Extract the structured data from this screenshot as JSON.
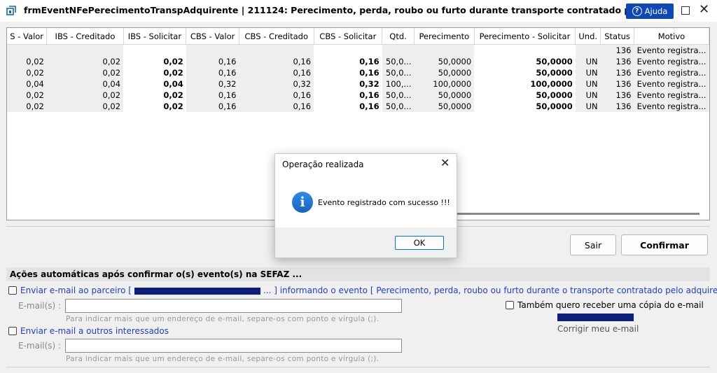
{
  "window": {
    "title": "frmEventNFePerecimentoTranspAdquirente | 211124: Perecimento, perda, roubo ou furto durante transporte contratado pelo",
    "help_label": "Ajuda",
    "app_icon": "document-icon"
  },
  "grid": {
    "columns": [
      "S - Valor",
      "IBS - Creditado",
      "IBS - Solicitar",
      "CBS - Valor",
      "CBS - Creditado",
      "CBS - Solicitar",
      "Qtd.",
      "Perecimento",
      "Perecimento - Solicitar",
      "Und.",
      "Status",
      "Motivo"
    ],
    "rows": [
      [
        "",
        "",
        "",
        "",
        "",
        "",
        "",
        "",
        "",
        "",
        "136",
        "Evento registra..."
      ],
      [
        "0,02",
        "0,02",
        "0,02",
        "0,16",
        "0,16",
        "0,16",
        "50,0...",
        "50,0000",
        "50,0000",
        "UN",
        "136",
        "Evento registra..."
      ],
      [
        "0,02",
        "0,02",
        "0,02",
        "0,16",
        "0,16",
        "0,16",
        "50,0...",
        "50,0000",
        "50,0000",
        "UN",
        "136",
        "Evento registra..."
      ],
      [
        "0,04",
        "0,04",
        "0,04",
        "0,32",
        "0,32",
        "0,32",
        "100,...",
        "100,0000",
        "100,0000",
        "UN",
        "136",
        "Evento registra..."
      ],
      [
        "0,02",
        "0,02",
        "0,02",
        "0,16",
        "0,16",
        "0,16",
        "50,0...",
        "50,0000",
        "50,0000",
        "UN",
        "136",
        "Evento registra..."
      ],
      [
        "0,02",
        "0,02",
        "0,02",
        "0,16",
        "0,16",
        "0,16",
        "50,0...",
        "50,0000",
        "50,0000",
        "UN",
        "136",
        "Evento registra..."
      ]
    ]
  },
  "buttons": {
    "sair": "Sair",
    "confirmar": "Confirmar"
  },
  "auto_actions": {
    "header": "Ações automáticas após confirmar o(s) evento(s) na SEFAZ ...",
    "opt1_prefix": "Enviar e-mail ao parceiro [",
    "opt1_suffix": "... ] informando o evento [ Perecimento, perda, roubo ou furto durante o transporte contratado pelo adquirente ]",
    "email_label": "E-mail(s) :",
    "email_value": "",
    "hint": "Para indicar mais que um endereço de e-mail, separe-os com ponto e vírgula (;).",
    "copy_label": "Também quero receber uma cópia do e-mail",
    "fix_email": "Corrigir meu e-mail",
    "opt2_label": "Enviar e-mail a outros interessados",
    "email2_label": "E-mail(s) :",
    "email2_value": "",
    "hint2": "Para indicar mais que um endereço de e-mail, separe-os com ponto e vírgula (;)."
  },
  "dialog": {
    "title": "Operação realizada",
    "message": "Evento registrado com sucesso !!!",
    "ok": "OK",
    "icon": "info-icon"
  },
  "colors": {
    "accent": "#0e47b8",
    "link": "#1f3fc4",
    "redaction": "#0c1f7c"
  }
}
